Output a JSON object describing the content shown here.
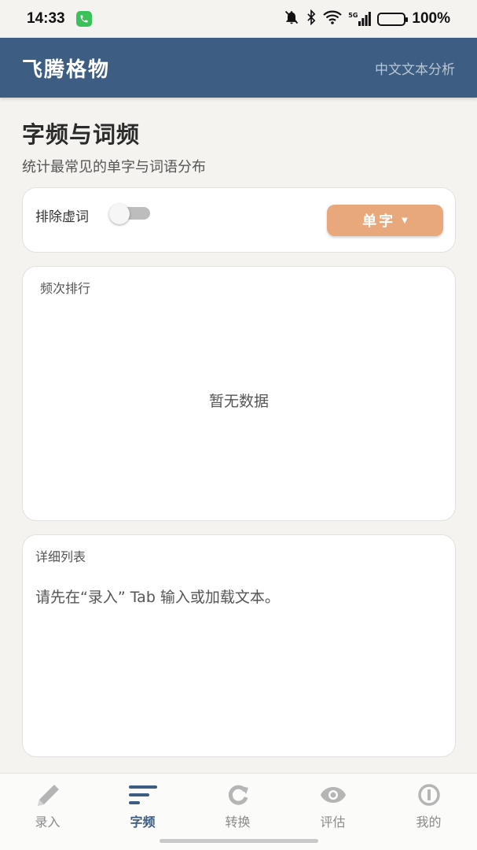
{
  "status_bar": {
    "time": "14:33",
    "battery": "100%",
    "signal_label": "5G"
  },
  "header": {
    "title": "飞腾格物",
    "subtitle": "中文文本分析"
  },
  "page": {
    "title": "字频与词频",
    "description": "统计最常见的单字与词语分布"
  },
  "controls": {
    "toggle_label": "排除虚词",
    "toggle_on": false,
    "mode_button_label": "单字",
    "mode_caret": "▼"
  },
  "rank_card": {
    "title": "频次排行",
    "empty_text": "暂无数据"
  },
  "detail_card": {
    "title": "详细列表",
    "hint": "请先在“录入” Tab 输入或加载文本。"
  },
  "nav": {
    "items": [
      {
        "label": "录入",
        "icon": "pencil-icon",
        "active": false
      },
      {
        "label": "字频",
        "icon": "bars-icon",
        "active": true
      },
      {
        "label": "转换",
        "icon": "refresh-icon",
        "active": false
      },
      {
        "label": "评估",
        "icon": "eye-icon",
        "active": false
      },
      {
        "label": "我的",
        "icon": "info-icon",
        "active": false
      }
    ]
  },
  "colors": {
    "header_bg": "#3d5d82",
    "accent_button": "#e8a87c",
    "page_bg": "#f4f3ef"
  }
}
